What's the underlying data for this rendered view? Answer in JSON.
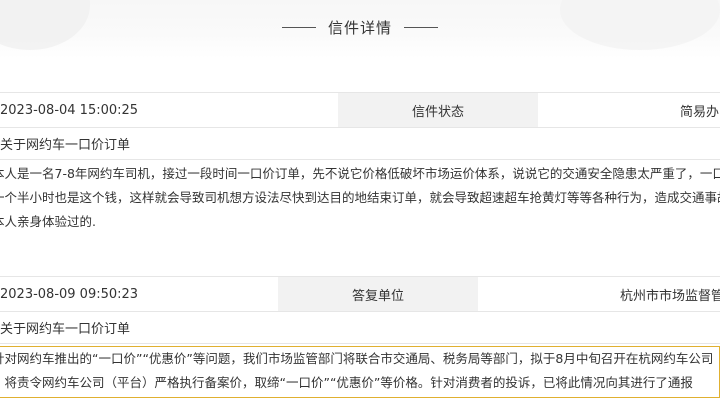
{
  "page_title": "信件详情",
  "letter": {
    "date": "2023-08-04 15:00:25",
    "status_label": "信件状态",
    "status_value": "简易办",
    "subject": "关于网约车一口价订单",
    "body_lines": [
      "本人是一名7-8年网约车司机，接过一段时间一口价订单，先不说它价格低破坏市场运价体系，说说它的交通安全隐患太严重了，一口价",
      "一个半小时也是这个钱，这样就会导致司机想方设法尽快到达目的地结束订单，就会导致超速超车抢黄灯等等各种行为，造成交通事故",
      "本人亲身体验过的."
    ]
  },
  "reply": {
    "date": "2023-08-09 09:50:23",
    "unit_label": "答复单位",
    "unit_value": "杭州市市场监督管理局",
    "subject": "关于网约车一口价订单",
    "body_lines": [
      "针对网约车推出的“一口价”“优惠价”等问题，我们市场监管部门将联合市交通局、税务局等部门，拟于8月中旬召开在杭网约车公司",
      "，将责令网约车公司（平台）严格执行备案价，取缔“一口价”“优惠价”等价格。针对消费者的投诉，已将此情况向其进行了通报"
    ]
  },
  "colors": {
    "label_bg": "#f2f2f2",
    "border": "#e6e6e6",
    "highlight_border": "#e0b030",
    "text": "#333333"
  }
}
